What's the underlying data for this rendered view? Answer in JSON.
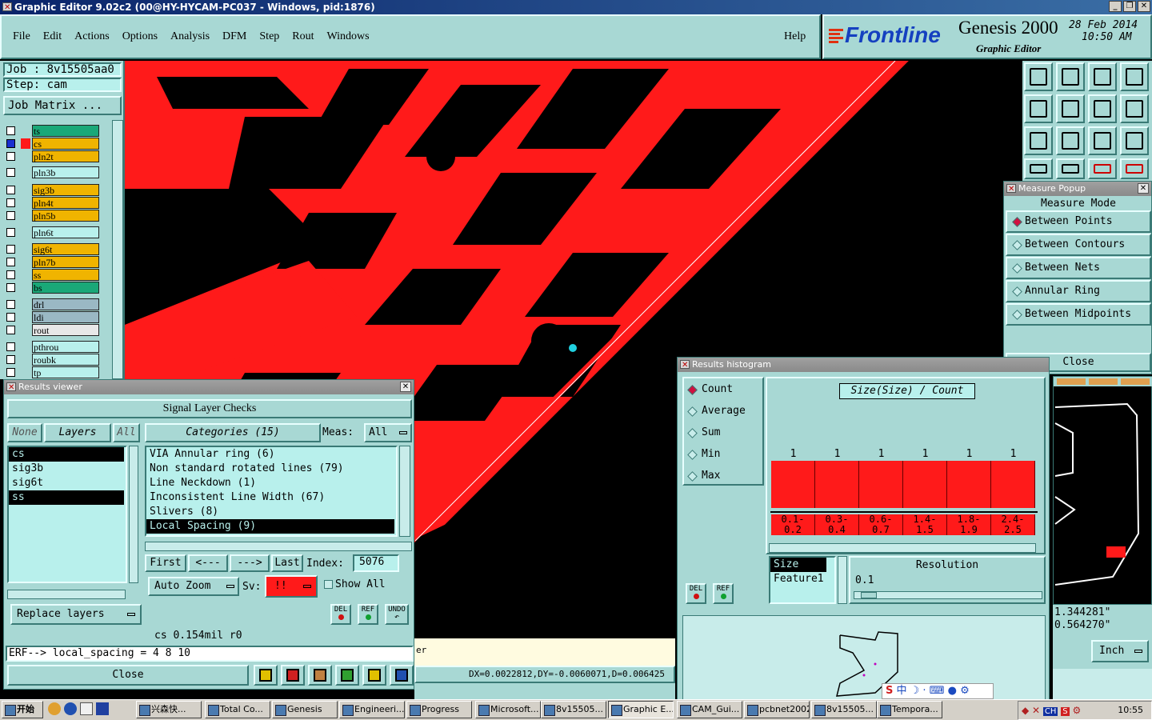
{
  "window": {
    "title": "Graphic Editor 9.02c2 (00@HY-HYCAM-PC037 - Windows, pid:1876)"
  },
  "menu": {
    "items": [
      "File",
      "Edit",
      "Actions",
      "Options",
      "Analysis",
      "DFM",
      "Step",
      "Rout",
      "Windows"
    ],
    "help": "Help"
  },
  "brand": {
    "logo": "Frontline",
    "product": "Genesis 2000",
    "subtitle": "Graphic Editor",
    "date": "28 Feb 2014",
    "time": "10:50 AM"
  },
  "job": {
    "job_label": "Job : 8v15505aa0",
    "step_label": "Step: cam",
    "matrix_button": "Job Matrix ..."
  },
  "layers": [
    {
      "name": "ts",
      "color": "#1aa878"
    },
    {
      "name": "cs",
      "color": "#f0b400",
      "active": true
    },
    {
      "name": "pln2t",
      "color": "#f0b400"
    },
    {
      "name": "pln3b",
      "color": "#b8f0ec"
    },
    {
      "name": "sig3b",
      "color": "#f0b400"
    },
    {
      "name": "pln4t",
      "color": "#f0b400"
    },
    {
      "name": "pln5b",
      "color": "#f0b400"
    },
    {
      "name": "pln6t",
      "color": "#b8f0ec"
    },
    {
      "name": "sig6t",
      "color": "#f0b400"
    },
    {
      "name": "pln7b",
      "color": "#f0b400"
    },
    {
      "name": "ss",
      "color": "#f0b400"
    },
    {
      "name": "bs",
      "color": "#1aa878"
    },
    {
      "name": "drl",
      "color": "#9ab8c4"
    },
    {
      "name": "ldi",
      "color": "#9ab8c4"
    },
    {
      "name": "rout",
      "color": "#e8e8e8"
    },
    {
      "name": "pthrou",
      "color": "#b8f0ec"
    },
    {
      "name": "roubk",
      "color": "#b8f0ec"
    },
    {
      "name": "tp",
      "color": "#b8f0ec"
    }
  ],
  "results_viewer": {
    "title": "Results viewer",
    "header": "Signal Layer Checks",
    "none_label": "None",
    "layers_label": "Layers",
    "all_label": "All",
    "categories_label": "Categories (15)",
    "meas_label": "Meas:",
    "meas_value": "All",
    "layer_list": [
      "cs",
      "sig3b",
      "sig6t",
      "ss"
    ],
    "categories": [
      "VIA Annular ring (6)",
      "Non standard rotated lines (79)",
      "Line Neckdown (1)",
      "Inconsistent Line Width (67)",
      "Slivers (8)",
      "Local Spacing (9)"
    ],
    "first": "First",
    "prev": "<---",
    "next": "--->",
    "last": "Last",
    "index_label": "Index:",
    "index_value": "5076",
    "autozoom": "Auto Zoom",
    "sv_label": "Sv:",
    "sv_value": "!!",
    "show_all": "Show All",
    "replace": "Replace layers",
    "status": "cs 0.154mil   r0",
    "erf": "ERF--> local_spacing = 4 8 10",
    "close": "Close",
    "del": "DEL",
    "ref": "REF",
    "undo": "UNDO"
  },
  "measure": {
    "title": "Measure Popup",
    "mode": "Measure Mode",
    "options": [
      "Between Points",
      "Between Contours",
      "Between Nets",
      "Annular Ring",
      "Between Midpoints"
    ],
    "close": "Close"
  },
  "histogram": {
    "title": "Results histogram",
    "options": [
      "Count",
      "Average",
      "Sum",
      "Min",
      "Max"
    ],
    "chart_title": "Size(Size) / Count",
    "counts": [
      "1",
      "1",
      "1",
      "1",
      "1",
      "1"
    ],
    "bins": [
      [
        "0.1-",
        "0.2"
      ],
      [
        "0.3-",
        "0.4"
      ],
      [
        "0.6-",
        "0.7"
      ],
      [
        "1.4-",
        "1.5"
      ],
      [
        "1.8-",
        "1.9"
      ],
      [
        "2.4-",
        "2.5"
      ]
    ],
    "list": [
      "Size",
      "Feature1"
    ],
    "resolution_label": "Resolution",
    "resolution_value": "0.1",
    "del": "DEL",
    "ref": "REF"
  },
  "coords": {
    "x": "1.344281\"",
    "y": "0.564270\"",
    "unit": "Inch"
  },
  "status_bar": {
    "dx": "DX=0.0022812,DY=-0.0060071,D=0.006425",
    "left_fragment": "er"
  },
  "taskbar": {
    "start": "开始",
    "items": [
      "兴森快...",
      "Total Co...",
      "Genesis",
      "Engineeri...",
      "Progress",
      "Microsoft...",
      "8v15505...",
      "Graphic E...",
      "CAM_Gui...",
      "pcbnet2002",
      "8v15505...",
      "Tempora..."
    ],
    "clock": "10:55"
  }
}
